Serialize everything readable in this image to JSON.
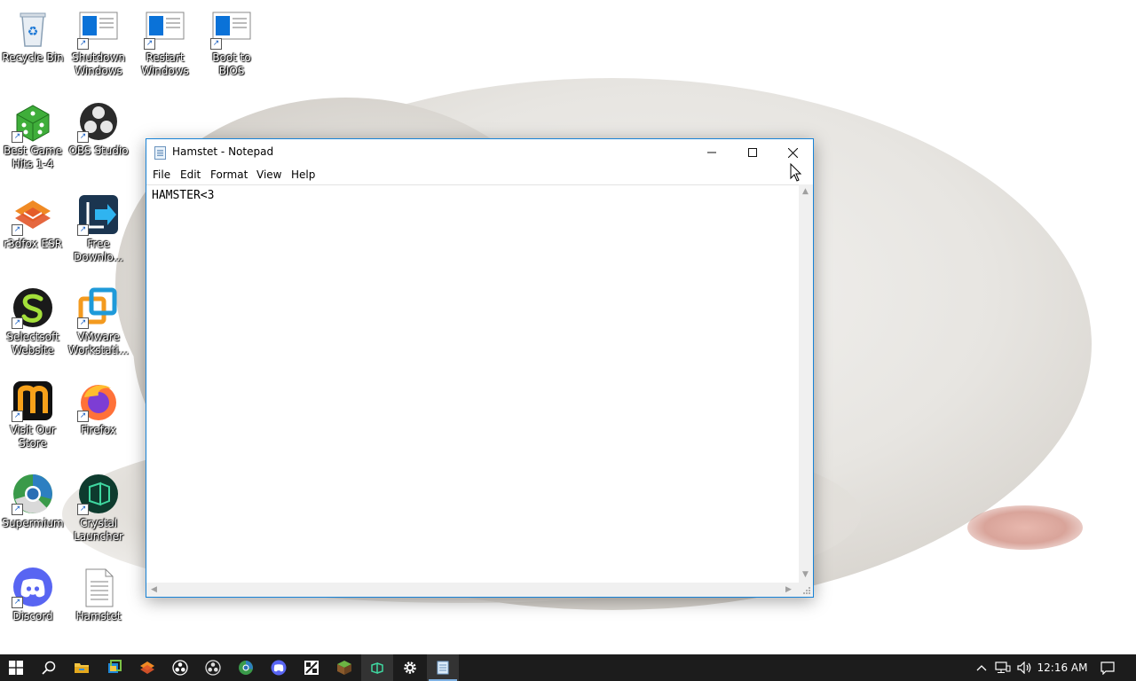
{
  "desktop": {
    "icons": [
      {
        "label": "Recycle Bin"
      },
      {
        "label": "Shutdown Windows"
      },
      {
        "label": "Restart Windows"
      },
      {
        "label": "Boot to BIOS"
      },
      {
        "label": "Best Game Hits 1-4"
      },
      {
        "label": "OBS Studio"
      },
      {
        "label": "r3dfox ESR"
      },
      {
        "label": "Free Downlo..."
      },
      {
        "label": "Selectsoft Website"
      },
      {
        "label": "VMware Workstati..."
      },
      {
        "label": "Visit Our Store"
      },
      {
        "label": "Firefox"
      },
      {
        "label": "Supermium"
      },
      {
        "label": "Crystal Launcher"
      },
      {
        "label": "Discord"
      },
      {
        "label": "Hamstet"
      }
    ]
  },
  "notepad": {
    "title": "Hamstet - Notepad",
    "menu": [
      "File",
      "Edit",
      "Format",
      "View",
      "Help"
    ],
    "content": "HAMSTER<3"
  },
  "taskbar": {
    "items": [
      {
        "icon": "windows-start-icon"
      },
      {
        "icon": "search-icon"
      },
      {
        "icon": "file-explorer-icon"
      },
      {
        "icon": "task-manager-icon"
      },
      {
        "icon": "r3dfox-icon"
      },
      {
        "icon": "obs-icon"
      },
      {
        "icon": "obs-studio-icon"
      },
      {
        "icon": "supermium-icon"
      },
      {
        "icon": "discord-icon"
      },
      {
        "icon": "vmware-icon"
      },
      {
        "icon": "minecraft-icon"
      },
      {
        "icon": "crystal-launcher-icon"
      },
      {
        "icon": "settings-icon"
      },
      {
        "icon": "notepad-icon"
      }
    ],
    "tray": {
      "clock": "12:16 AM"
    }
  },
  "colors": {
    "accent": "#1883d7",
    "taskbar": "#1c1c1c",
    "discord": "#5865f2",
    "firefox": "#ff7139"
  }
}
